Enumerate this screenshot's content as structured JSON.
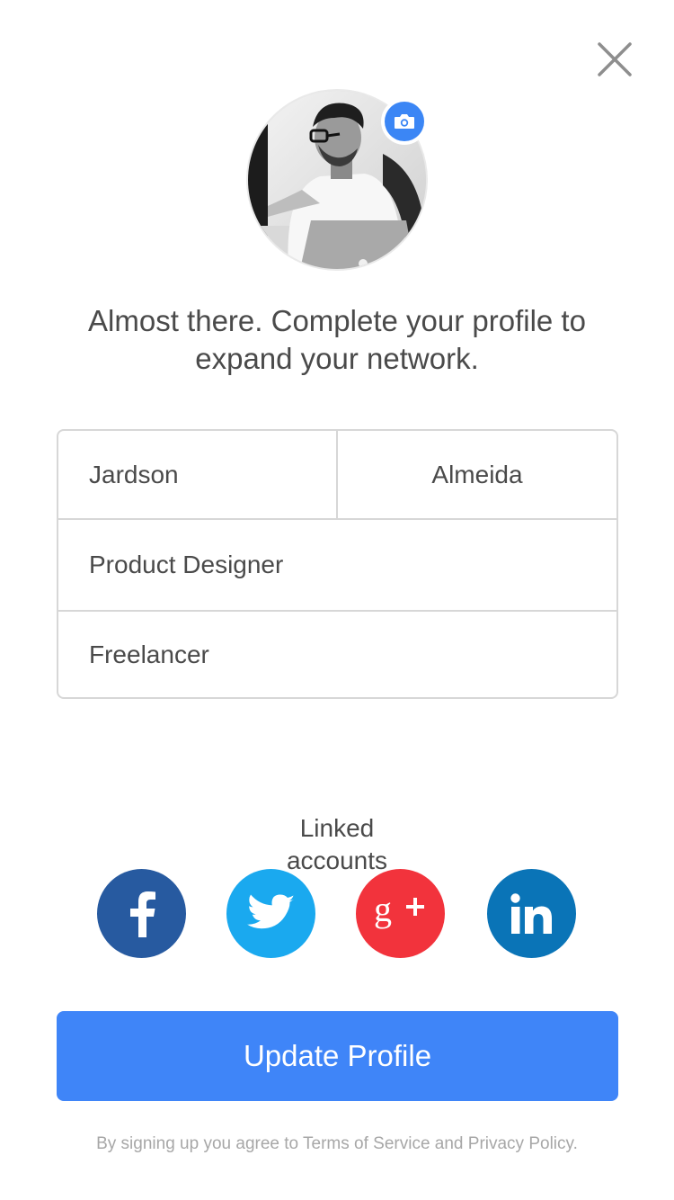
{
  "header": {
    "close_icon": "close-icon"
  },
  "avatar": {
    "camera_icon": "camera-icon",
    "accent_color": "#3b86f5"
  },
  "headline": "Almost there. Complete your profile to expand your network.",
  "form": {
    "first_name": "Jardson",
    "last_name": "Almeida",
    "job_title": "Product Designer",
    "employment": "Freelancer"
  },
  "linked_accounts": {
    "label": "Linked accounts",
    "services": [
      {
        "name": "facebook",
        "icon": "facebook-icon",
        "color": "#275aa0"
      },
      {
        "name": "twitter",
        "icon": "twitter-icon",
        "color": "#1aa9ef"
      },
      {
        "name": "google-plus",
        "icon": "google-plus-icon",
        "color": "#f2333c"
      },
      {
        "name": "linkedin",
        "icon": "linkedin-icon",
        "color": "#0a74b7"
      }
    ]
  },
  "update_button": {
    "label": "Update Profile",
    "color": "#3f85f8"
  },
  "legal_text": "By signing up you agree to Terms of Service and Privacy Policy."
}
